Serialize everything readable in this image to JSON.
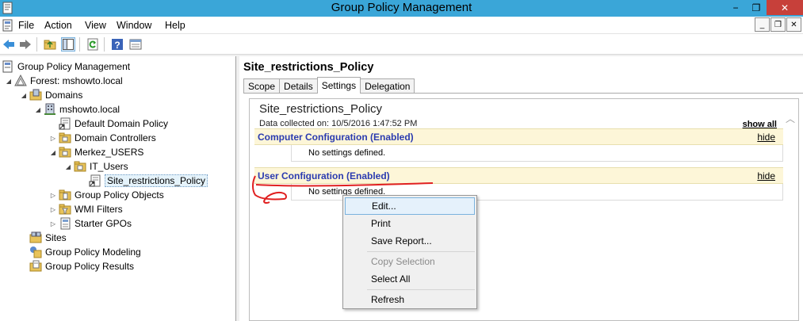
{
  "window": {
    "title": "Group Policy Management",
    "min": "−",
    "max": "❐",
    "close": "✕"
  },
  "menubar": {
    "items": [
      "File",
      "Action",
      "View",
      "Window",
      "Help"
    ],
    "mdi_min": "_",
    "mdi_restore": "❐",
    "mdi_close": "✕"
  },
  "toolbar": {
    "icons": [
      "back-arrow-icon",
      "forward-arrow-icon",
      "up-folder-icon",
      "show-hide-tree-icon",
      "refresh-icon",
      "help-icon",
      "properties-icon"
    ]
  },
  "tree": {
    "root": "Group Policy Management",
    "forest": "Forest: mshowto.local",
    "domains": "Domains",
    "domain": "mshowto.local",
    "default_policy": "Default Domain Policy",
    "domain_controllers": "Domain Controllers",
    "merkez_users": "Merkez_USERS",
    "it_users": "IT_Users",
    "site_policy": "Site_restrictions_Policy",
    "gpo_objects": "Group Policy Objects",
    "wmi_filters": "WMI Filters",
    "starter_gpos": "Starter GPOs",
    "sites": "Sites",
    "modeling": "Group Policy Modeling",
    "results": "Group Policy Results"
  },
  "detail": {
    "title": "Site_restrictions_Policy",
    "tabs": [
      "Scope",
      "Details",
      "Settings",
      "Delegation"
    ],
    "active_tab": "Settings",
    "report_title": "Site_restrictions_Policy",
    "collected": "Data collected on: 10/5/2016 1:47:52 PM",
    "show_all": "show all",
    "computer_config": "Computer Configuration (Enabled)",
    "computer_hide": "hide",
    "computer_body": "No settings defined.",
    "user_config": "User Configuration (Enabled)",
    "user_hide": "hide",
    "user_body": "No settings defined."
  },
  "context_menu": {
    "edit": "Edit...",
    "print": "Print",
    "save_report": "Save Report...",
    "copy_selection": "Copy Selection",
    "select_all": "Select All",
    "refresh": "Refresh",
    "highlighted": "Edit..."
  },
  "colors": {
    "titlebar": "#3aa6d8",
    "section_header_bg": "#fdf6d8",
    "section_link": "#2b3bb0",
    "annotation": "#e02020",
    "close_btn": "#c7403a"
  }
}
